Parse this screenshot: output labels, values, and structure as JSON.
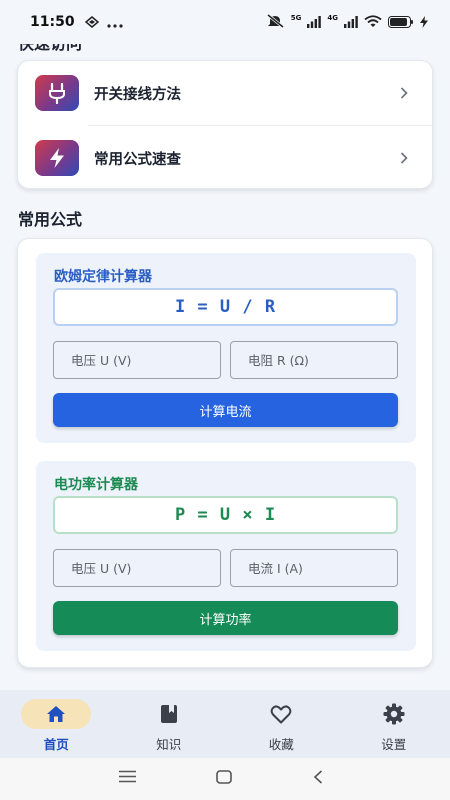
{
  "status_bar": {
    "time": "11:50",
    "net_5g": "5G",
    "net_4g": "4G"
  },
  "quick_access": {
    "partial_heading": "快速访问",
    "items": [
      {
        "label": "开关接线方法",
        "icon": "plug-icon"
      },
      {
        "label": "常用公式速查",
        "icon": "lightning-icon"
      }
    ]
  },
  "formulas": {
    "section_title": "常用公式",
    "ohm": {
      "title": "欧姆定律计算器",
      "formula": "I = U / R",
      "input_voltage_placeholder": "电压 U (V)",
      "input_resistance_placeholder": "电阻 R (Ω)",
      "button_label": "计算电流"
    },
    "power": {
      "title": "电功率计算器",
      "formula": "P = U × I",
      "input_voltage_placeholder": "电压 U (V)",
      "input_current_placeholder": "电流 I (A)",
      "button_label": "计算功率"
    }
  },
  "bottom_nav": {
    "items": [
      {
        "label": "首页",
        "icon": "home-icon",
        "active": true
      },
      {
        "label": "知识",
        "icon": "book-icon",
        "active": false
      },
      {
        "label": "收藏",
        "icon": "heart-icon",
        "active": false
      },
      {
        "label": "设置",
        "icon": "gear-icon",
        "active": false
      }
    ]
  },
  "colors": {
    "primary_blue": "#2563e0",
    "primary_green": "#158c57",
    "active_pill": "#f7e3b8",
    "background": "#f3f6fb"
  }
}
